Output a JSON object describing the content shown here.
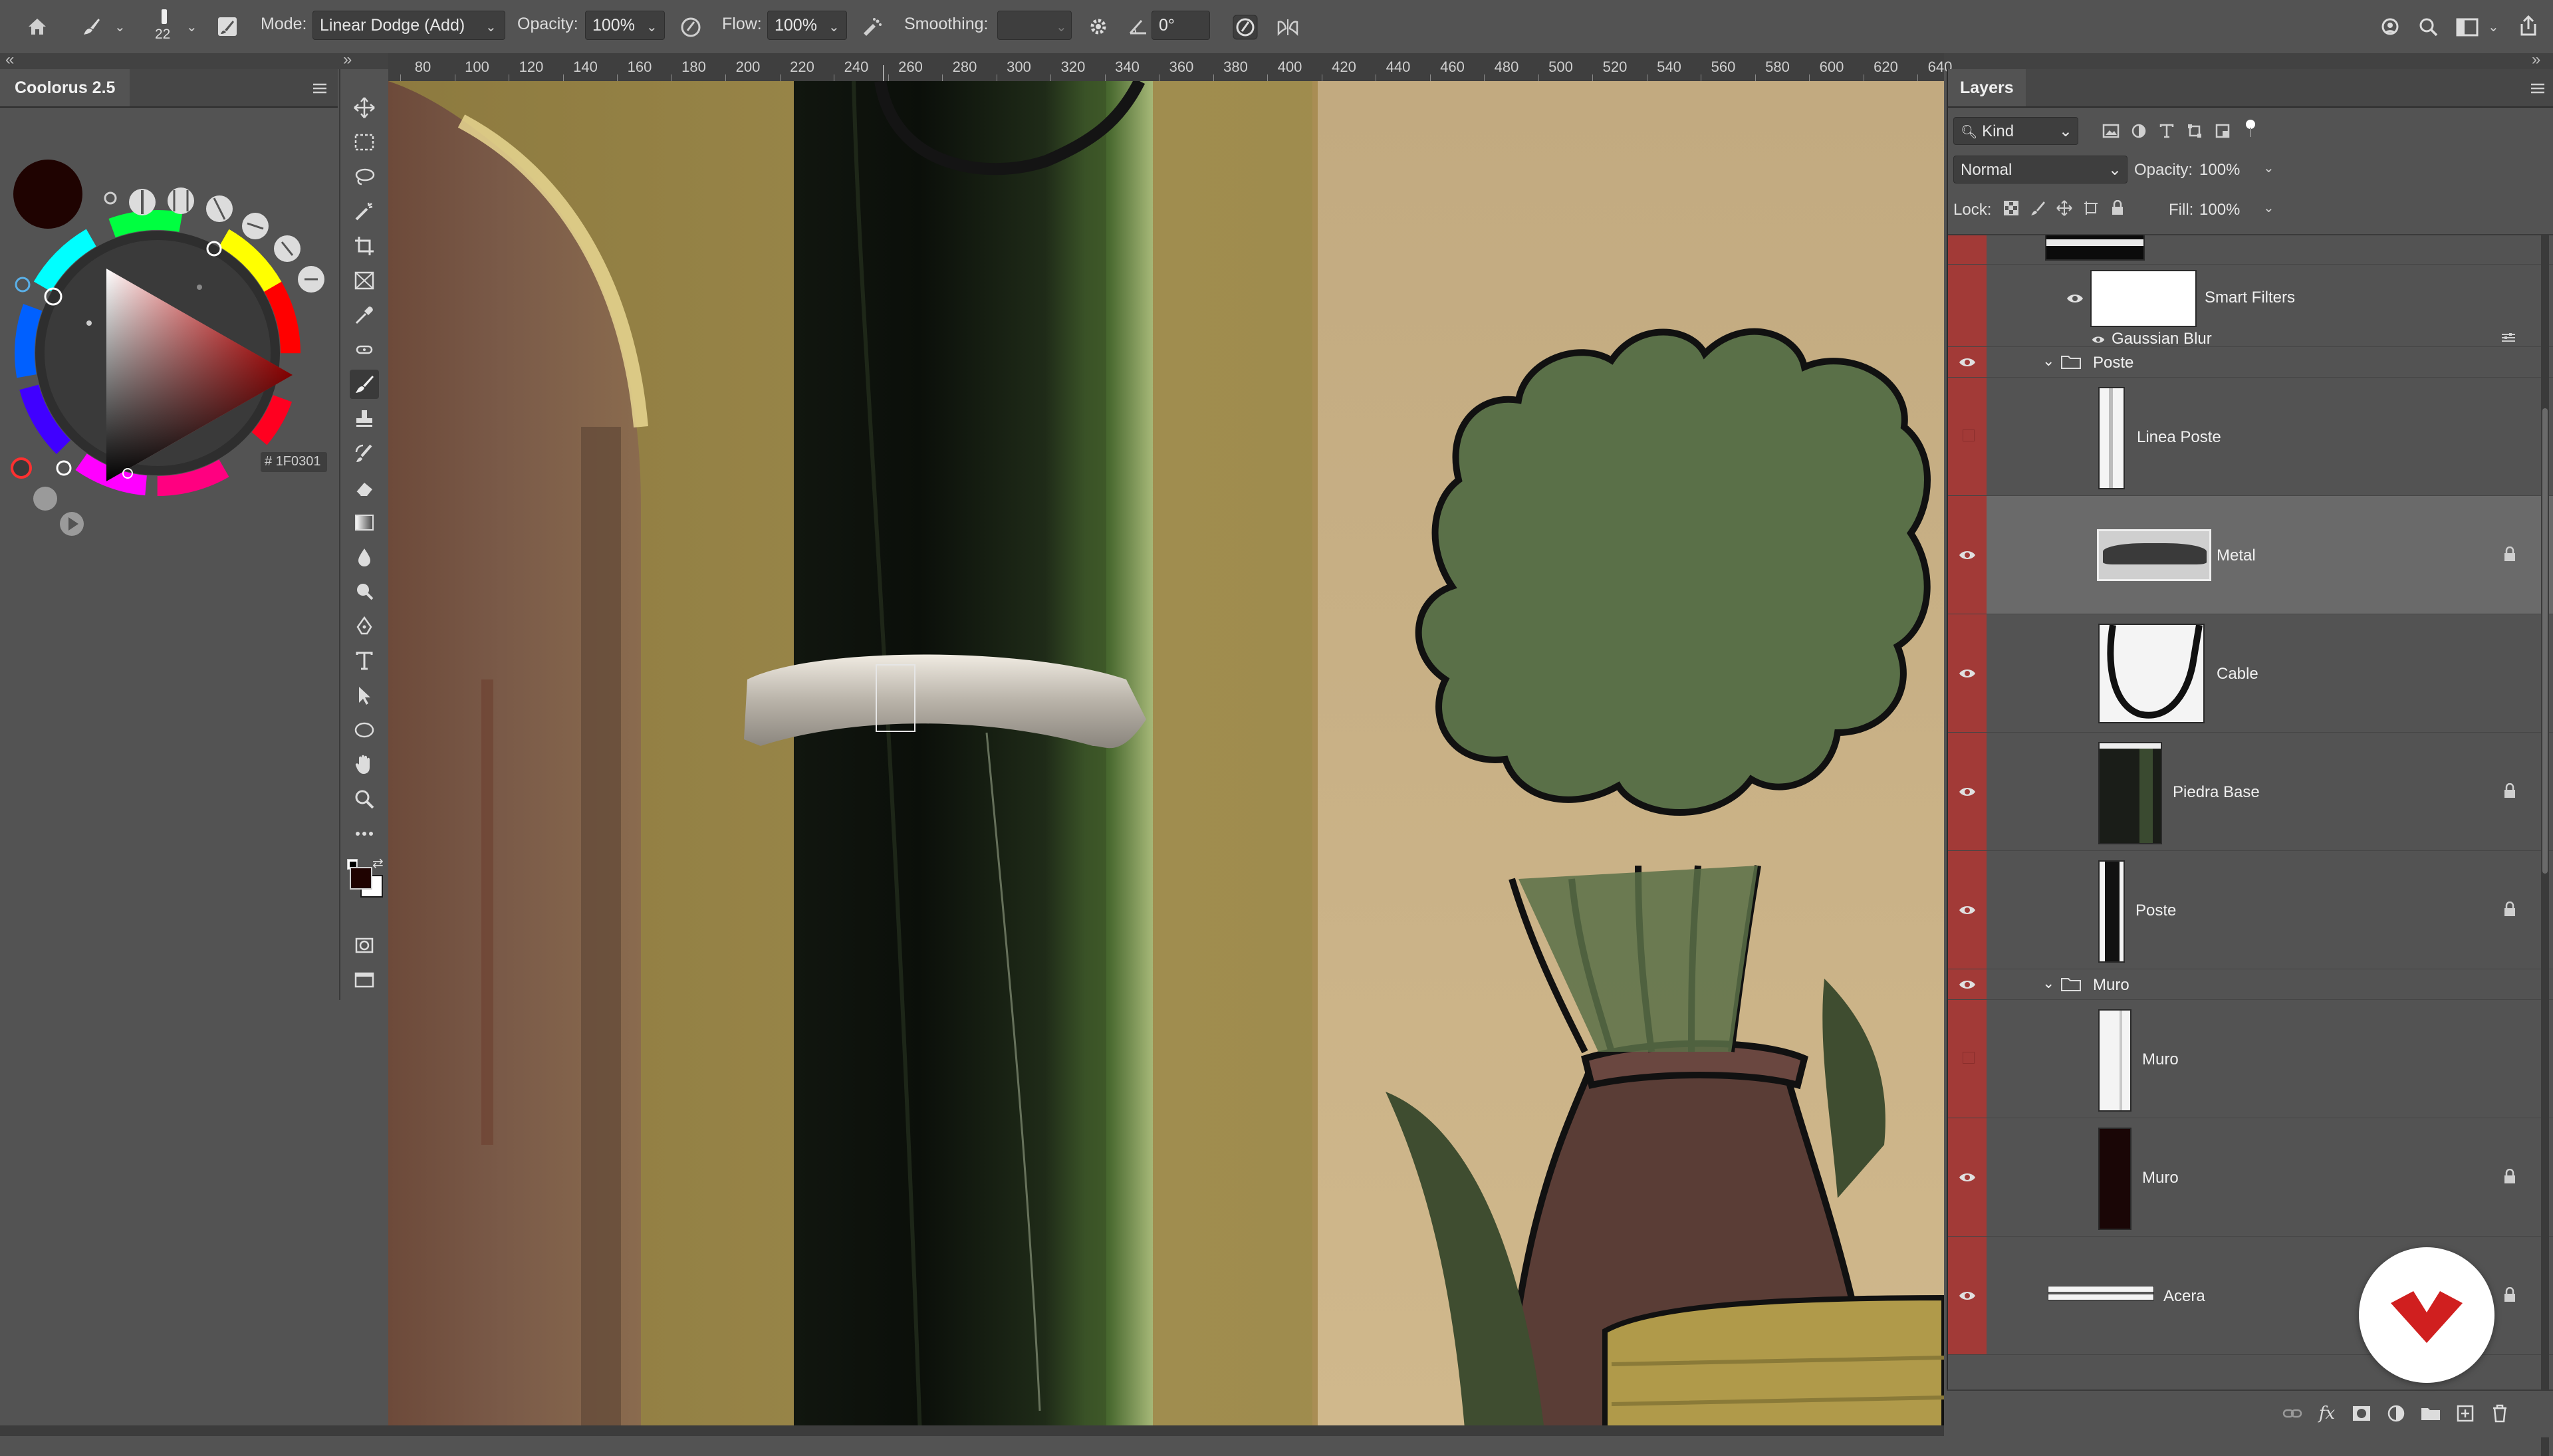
{
  "options_bar": {
    "brush_size": "22",
    "mode_label": "Mode:",
    "mode_value": "Linear Dodge (Add)",
    "opacity_label": "Opacity:",
    "opacity_value": "100%",
    "flow_label": "Flow:",
    "flow_value": "100%",
    "smoothing_label": "Smoothing:",
    "smoothing_value": "",
    "angle_value": "0°"
  },
  "coolorus": {
    "title": "Coolorus 2.5",
    "hex_label": "#",
    "hex_value": "1F0301",
    "current_color": "#1f0301"
  },
  "ruler": {
    "labels": [
      "80",
      "100",
      "120",
      "140",
      "160",
      "180",
      "200",
      "220",
      "240",
      "260",
      "280",
      "300",
      "320",
      "340",
      "360",
      "380",
      "400",
      "420",
      "440",
      "460",
      "480",
      "500",
      "520",
      "540",
      "560",
      "580",
      "600",
      "620",
      "640"
    ]
  },
  "layers_panel": {
    "title": "Layers",
    "filter_label": "Kind",
    "blend_mode": "Normal",
    "opacity_label": "Opacity:",
    "opacity_value": "100%",
    "lock_label": "Lock:",
    "fill_label": "Fill:",
    "fill_value": "100%",
    "smart_filters_label": "Smart Filters",
    "gaussian_blur_label": "Gaussian Blur",
    "group_poste": "Poste",
    "layer_linea_poste": "Linea Poste",
    "layer_metal": "Metal",
    "layer_cable": "Cable",
    "layer_piedra_base": "Piedra Base",
    "layer_poste": "Poste",
    "group_muro": "Muro",
    "layer_muro_1": "Muro",
    "layer_muro_2": "Muro",
    "layer_acera": "Acera"
  },
  "colors": {
    "ui_bg": "#535353",
    "panel_dark": "#3e3e3e",
    "visibility_column": "#a23a37",
    "selected_row": "#6a6a6a",
    "logo_red": "#d01f1f"
  },
  "icons": [
    "home-icon",
    "brush-icon",
    "brush-settings-icon",
    "airbrush-icon",
    "pressure-opacity-icon",
    "smoothing-gear-icon",
    "angle-icon",
    "pressure-size-icon",
    "symmetry-icon",
    "cloud-icon",
    "search-icon",
    "workspace-icon",
    "share-icon",
    "move-icon",
    "marquee-icon",
    "lasso-icon",
    "magic-wand-icon",
    "crop-icon",
    "frame-icon",
    "eyedropper-icon",
    "spot-healing-icon",
    "brush-tool-icon",
    "stamp-icon",
    "history-brush-icon",
    "eraser-icon",
    "gradient-icon",
    "blur-icon",
    "dodge-icon",
    "pen-icon",
    "type-icon",
    "path-select-icon",
    "ellipse-icon",
    "hand-icon",
    "zoom-icon",
    "more-icon",
    "eye-icon",
    "folder-icon",
    "lock-icon",
    "link-icon",
    "fx-icon",
    "mask-icon",
    "adjustment-icon",
    "new-group-icon",
    "new-layer-icon",
    "trash-icon"
  ]
}
